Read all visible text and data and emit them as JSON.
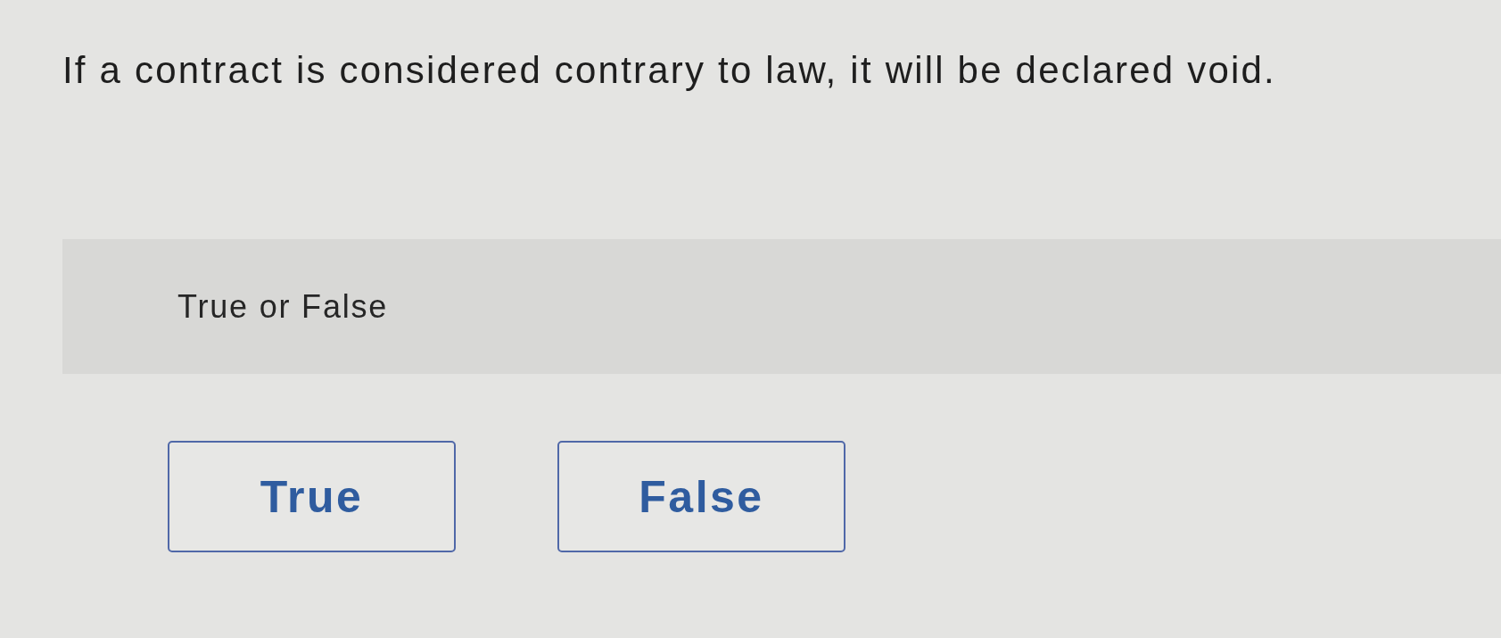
{
  "question": {
    "text": "If a contract is considered contrary to law, it will be declared void."
  },
  "prompt": {
    "text": "True or False"
  },
  "options": [
    {
      "label": "True",
      "selected": false
    },
    {
      "label": "False",
      "selected": false
    }
  ]
}
